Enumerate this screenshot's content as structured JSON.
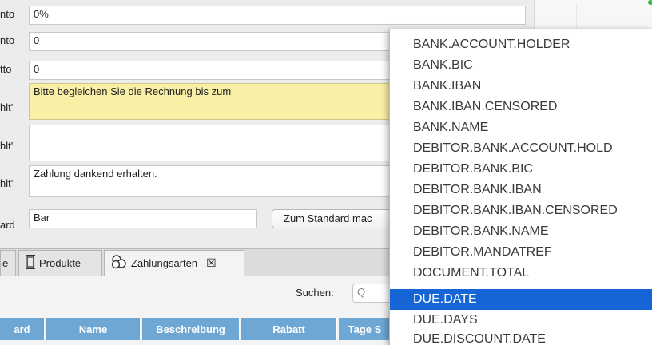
{
  "form": {
    "row1": {
      "label": "nto",
      "value": "0%"
    },
    "row2": {
      "label": "nto",
      "value": "0"
    },
    "row3": {
      "label": "tto",
      "value": "0"
    },
    "row4": {
      "label": "hlt'",
      "value": "Bitte begleichen Sie die Rechnung bis zum"
    },
    "row5": {
      "label": "hlt'",
      "value": ""
    },
    "row6": {
      "label": "hlt'",
      "value": "Zahlung dankend erhalten."
    },
    "row7": {
      "label": "ard",
      "value": "Bar"
    },
    "standard_button": "Zum Standard mac"
  },
  "tabs": [
    {
      "label": "e"
    },
    {
      "label": "Produkte"
    },
    {
      "label": "Zahlungsarten",
      "close": "☒"
    }
  ],
  "search": {
    "label": "Suchen:",
    "icon_glyph": "Q"
  },
  "table": {
    "headers": [
      "ard",
      "Name",
      "Beschreibung",
      "Rabatt",
      "Tage S"
    ]
  },
  "dropdown": {
    "items": [
      "BANK.ACCOUNT.HOLDER",
      "BANK.BIC",
      "BANK.IBAN",
      "BANK.IBAN.CENSORED",
      "BANK.NAME",
      "DEBITOR.BANK.ACCOUNT.HOLD",
      "DEBITOR.BANK.BIC",
      "DEBITOR.BANK.IBAN",
      "DEBITOR.BANK.IBAN.CENSORED",
      "DEBITOR.BANK.NAME",
      "DEBITOR.MANDATREF",
      "DOCUMENT.TOTAL",
      "DUE.DATE",
      "DUE.DAYS",
      "DUE.DISCOUNT.DATE"
    ],
    "selected": "DUE.DATE"
  },
  "colors": {
    "accent": "#1565d6",
    "header": "#6ea7d3",
    "highlight_field": "#f9f0a6"
  }
}
